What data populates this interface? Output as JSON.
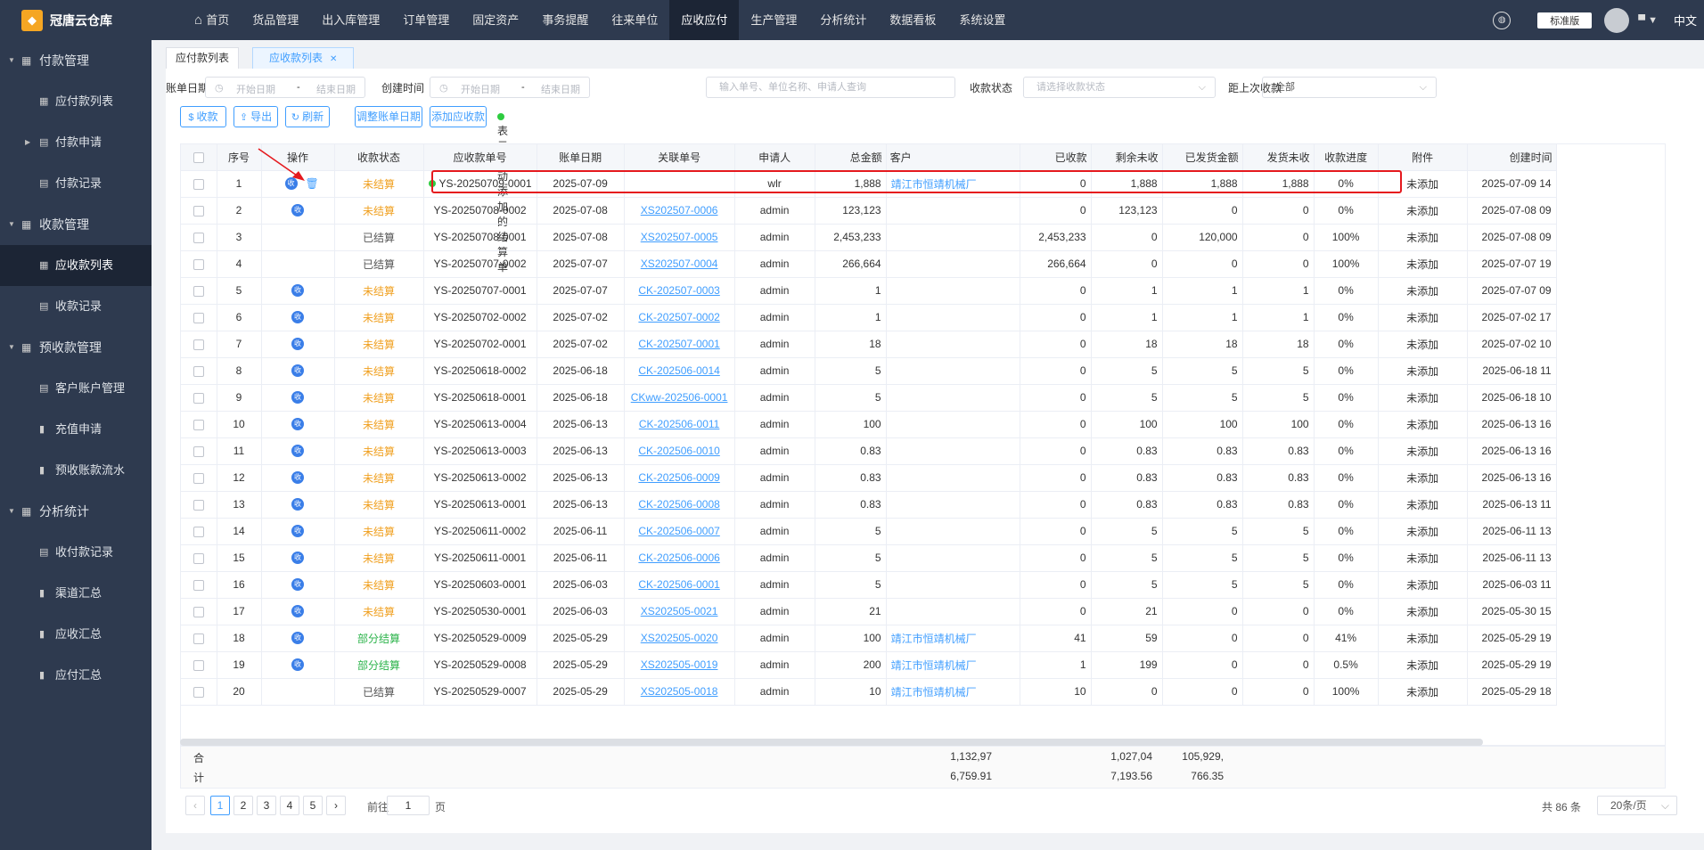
{
  "app": {
    "title": "冠唐云仓库",
    "logo_icon": "logo-icon"
  },
  "topnav": [
    {
      "label": "首页",
      "icon": "home-icon"
    },
    {
      "label": "货品管理"
    },
    {
      "label": "出入库管理"
    },
    {
      "label": "订单管理"
    },
    {
      "label": "固定资产"
    },
    {
      "label": "事务提醒"
    },
    {
      "label": "往来单位"
    },
    {
      "label": "应收应付",
      "active": true
    },
    {
      "label": "生产管理"
    },
    {
      "label": "分析统计"
    },
    {
      "label": "数据看板"
    },
    {
      "label": "系统设置"
    }
  ],
  "topright": {
    "edition": "标准版",
    "lang": "中文"
  },
  "sidebar": [
    {
      "type": "group",
      "label": "付款管理",
      "icon": "grid-icon"
    },
    {
      "type": "item",
      "label": "应付款列表",
      "icon": "table-icon"
    },
    {
      "type": "item",
      "label": "付款申请",
      "icon": "doc-icon",
      "arrow": true
    },
    {
      "type": "item",
      "label": "付款记录",
      "icon": "doc-icon"
    },
    {
      "type": "group",
      "label": "收款管理",
      "icon": "grid-icon"
    },
    {
      "type": "item",
      "label": "应收款列表",
      "icon": "table-icon",
      "active": true
    },
    {
      "type": "item",
      "label": "收款记录",
      "icon": "doc-icon"
    },
    {
      "type": "group",
      "label": "预收款管理",
      "icon": "grid-icon"
    },
    {
      "type": "item",
      "label": "客户账户管理",
      "icon": "doc-icon"
    },
    {
      "type": "item",
      "label": "充值申请",
      "icon": "bar-icon"
    },
    {
      "type": "item",
      "label": "预收账款流水",
      "icon": "bar-icon"
    },
    {
      "type": "group",
      "label": "分析统计",
      "icon": "grid-icon"
    },
    {
      "type": "item",
      "label": "收付款记录",
      "icon": "doc-icon"
    },
    {
      "type": "item",
      "label": "渠道汇总",
      "icon": "bar-icon"
    },
    {
      "type": "item",
      "label": "应收汇总",
      "icon": "bar-icon"
    },
    {
      "type": "item",
      "label": "应付汇总",
      "icon": "bar-icon"
    }
  ],
  "tabs": [
    {
      "label": "应付款列表"
    },
    {
      "label": "应收款列表",
      "active": true
    }
  ],
  "filters": {
    "bill_date_label": "账单日期",
    "start": "开始日期",
    "sep": "-",
    "end": "结束日期",
    "create_time_label": "创建时间",
    "search_placeholder": "输入单号、单位名称、申请人查询",
    "status_label": "收款状态",
    "status_placeholder": "请选择收款状态",
    "last_label": "距上次收款",
    "last_value": "全部"
  },
  "actions": {
    "receive": "收款",
    "export": "导出",
    "refresh": "刷新",
    "adjust": "调整账单日期",
    "add": "添加应收款",
    "hint": "表示手动添加的结算单"
  },
  "columns": [
    "序号",
    "操作",
    "收款状态",
    "应收款单号",
    "账单日期",
    "关联单号",
    "申请人",
    "总金额",
    "客户",
    "已收款",
    "剩余未收",
    "已发货金额",
    "发货未收",
    "收款进度",
    "附件",
    "创建时间"
  ],
  "rows": [
    {
      "no": "1",
      "op": true,
      "del": true,
      "status": "未结算",
      "st": 0,
      "manual": true,
      "code": "YS-20250709-0001",
      "date": "2025-07-09",
      "link": "",
      "linkStyle": "none",
      "applicant": "wlr",
      "total": "1,888",
      "customer": "",
      "received": "0",
      "remain": "1,888",
      "shipped": "1,888",
      "unpaid": "1,888",
      "progress": "0%",
      "attach": "未添加",
      "created": "2025-07-09 14"
    },
    {
      "no": "2",
      "op": true,
      "status": "未结算",
      "st": 0,
      "code": "YS-20250708-0002",
      "date": "2025-07-08",
      "link": "XS202507-0006",
      "linkStyle": "u",
      "applicant": "admin",
      "total": "123,123",
      "customer": "",
      "received": "0",
      "remain": "123,123",
      "shipped": "0",
      "unpaid": "0",
      "progress": "0%",
      "attach": "未添加",
      "created": "2025-07-08 09"
    },
    {
      "no": "3",
      "op": false,
      "status": "已结算",
      "st": 2,
      "code": "YS-20250708-0001",
      "date": "2025-07-08",
      "link": "XS202507-0005",
      "linkStyle": "u",
      "applicant": "admin",
      "total": "2,453,233",
      "customer": "",
      "received": "2,453,233",
      "remain": "0",
      "shipped": "120,000",
      "unpaid": "0",
      "progress": "100%",
      "attach": "未添加",
      "created": "2025-07-08 09"
    },
    {
      "no": "4",
      "op": false,
      "status": "已结算",
      "st": 2,
      "code": "YS-20250707-0002",
      "date": "2025-07-07",
      "link": "XS202507-0004",
      "linkStyle": "u",
      "applicant": "admin",
      "total": "266,664",
      "customer": "",
      "received": "266,664",
      "remain": "0",
      "shipped": "0",
      "unpaid": "0",
      "progress": "100%",
      "attach": "未添加",
      "created": "2025-07-07 19"
    },
    {
      "no": "5",
      "op": true,
      "status": "未结算",
      "st": 0,
      "code": "YS-20250707-0001",
      "date": "2025-07-07",
      "link": "CK-202507-0003",
      "linkStyle": "u",
      "applicant": "admin",
      "total": "1",
      "customer": "",
      "received": "0",
      "remain": "1",
      "shipped": "1",
      "unpaid": "1",
      "progress": "0%",
      "attach": "未添加",
      "created": "2025-07-07 09"
    },
    {
      "no": "6",
      "op": true,
      "status": "未结算",
      "st": 0,
      "code": "YS-20250702-0002",
      "date": "2025-07-02",
      "link": "CK-202507-0002",
      "linkStyle": "u",
      "applicant": "admin",
      "total": "1",
      "customer": "",
      "received": "0",
      "remain": "1",
      "shipped": "1",
      "unpaid": "1",
      "progress": "0%",
      "attach": "未添加",
      "created": "2025-07-02 17"
    },
    {
      "no": "7",
      "op": true,
      "status": "未结算",
      "st": 0,
      "code": "YS-20250702-0001",
      "date": "2025-07-02",
      "link": "CK-202507-0001",
      "linkStyle": "u",
      "applicant": "admin",
      "total": "18",
      "customer": "",
      "received": "0",
      "remain": "18",
      "shipped": "18",
      "unpaid": "18",
      "progress": "0%",
      "attach": "未添加",
      "created": "2025-07-02 10"
    },
    {
      "no": "8",
      "op": true,
      "status": "未结算",
      "st": 0,
      "code": "YS-20250618-0002",
      "date": "2025-06-18",
      "link": "CK-202506-0014",
      "linkStyle": "u",
      "applicant": "admin",
      "total": "5",
      "customer": "",
      "received": "0",
      "remain": "5",
      "shipped": "5",
      "unpaid": "5",
      "progress": "0%",
      "attach": "未添加",
      "created": "2025-06-18 11"
    },
    {
      "no": "9",
      "op": true,
      "status": "未结算",
      "st": 0,
      "code": "YS-20250618-0001",
      "date": "2025-06-18",
      "link": "CKww-202506-0001",
      "linkStyle": "u",
      "applicant": "admin",
      "total": "5",
      "customer": "",
      "received": "0",
      "remain": "5",
      "shipped": "5",
      "unpaid": "5",
      "progress": "0%",
      "attach": "未添加",
      "created": "2025-06-18 10"
    },
    {
      "no": "10",
      "op": true,
      "status": "未结算",
      "st": 0,
      "code": "YS-20250613-0004",
      "date": "2025-06-13",
      "link": "CK-202506-0011",
      "linkStyle": "u",
      "applicant": "admin",
      "total": "100",
      "customer": "",
      "received": "0",
      "remain": "100",
      "shipped": "100",
      "unpaid": "100",
      "progress": "0%",
      "attach": "未添加",
      "created": "2025-06-13 16"
    },
    {
      "no": "11",
      "op": true,
      "status": "未结算",
      "st": 0,
      "code": "YS-20250613-0003",
      "date": "2025-06-13",
      "link": "CK-202506-0010",
      "linkStyle": "u",
      "applicant": "admin",
      "total": "0.83",
      "customer": "",
      "received": "0",
      "remain": "0.83",
      "shipped": "0.83",
      "unpaid": "0.83",
      "progress": "0%",
      "attach": "未添加",
      "created": "2025-06-13 16"
    },
    {
      "no": "12",
      "op": true,
      "status": "未结算",
      "st": 0,
      "code": "YS-20250613-0002",
      "date": "2025-06-13",
      "link": "CK-202506-0009",
      "linkStyle": "u",
      "applicant": "admin",
      "total": "0.83",
      "customer": "",
      "received": "0",
      "remain": "0.83",
      "shipped": "0.83",
      "unpaid": "0.83",
      "progress": "0%",
      "attach": "未添加",
      "created": "2025-06-13 16"
    },
    {
      "no": "13",
      "op": true,
      "status": "未结算",
      "st": 0,
      "code": "YS-20250613-0001",
      "date": "2025-06-13",
      "link": "CK-202506-0008",
      "linkStyle": "u",
      "applicant": "admin",
      "total": "0.83",
      "customer": "",
      "received": "0",
      "remain": "0.83",
      "shipped": "0.83",
      "unpaid": "0.83",
      "progress": "0%",
      "attach": "未添加",
      "created": "2025-06-13 11"
    },
    {
      "no": "14",
      "op": true,
      "status": "未结算",
      "st": 0,
      "code": "YS-20250611-0002",
      "date": "2025-06-11",
      "link": "CK-202506-0007",
      "linkStyle": "u",
      "applicant": "admin",
      "total": "5",
      "customer": "",
      "received": "0",
      "remain": "5",
      "shipped": "5",
      "unpaid": "5",
      "progress": "0%",
      "attach": "未添加",
      "created": "2025-06-11 13"
    },
    {
      "no": "15",
      "op": true,
      "status": "未结算",
      "st": 0,
      "code": "YS-20250611-0001",
      "date": "2025-06-11",
      "link": "CK-202506-0006",
      "linkStyle": "u",
      "applicant": "admin",
      "total": "5",
      "customer": "",
      "received": "0",
      "remain": "5",
      "shipped": "5",
      "unpaid": "5",
      "progress": "0%",
      "attach": "未添加",
      "created": "2025-06-11 13"
    },
    {
      "no": "16",
      "op": true,
      "status": "未结算",
      "st": 0,
      "code": "YS-20250603-0001",
      "date": "2025-06-03",
      "link": "CK-202506-0001",
      "linkStyle": "u",
      "applicant": "admin",
      "total": "5",
      "customer": "",
      "received": "0",
      "remain": "5",
      "shipped": "5",
      "unpaid": "5",
      "progress": "0%",
      "attach": "未添加",
      "created": "2025-06-03 11"
    },
    {
      "no": "17",
      "op": true,
      "status": "未结算",
      "st": 0,
      "code": "YS-20250530-0001",
      "date": "2025-06-03",
      "link": "XS202505-0021",
      "linkStyle": "u",
      "applicant": "admin",
      "total": "21",
      "customer": "",
      "received": "0",
      "remain": "21",
      "shipped": "0",
      "unpaid": "0",
      "progress": "0%",
      "attach": "未添加",
      "created": "2025-05-30 15"
    },
    {
      "no": "18",
      "op": true,
      "status": "部分结算",
      "st": 1,
      "code": "YS-20250529-0009",
      "date": "2025-05-29",
      "link": "XS202505-0020",
      "linkStyle": "u",
      "applicant": "admin",
      "total": "100",
      "customer": "靖江市恒靖机械厂",
      "received": "41",
      "remain": "59",
      "shipped": "0",
      "unpaid": "0",
      "progress": "41%",
      "attach": "未添加",
      "created": "2025-05-29 19"
    },
    {
      "no": "19",
      "op": true,
      "status": "部分结算",
      "st": 1,
      "code": "YS-20250529-0008",
      "date": "2025-05-29",
      "link": "XS202505-0019",
      "linkStyle": "u",
      "applicant": "admin",
      "total": "200",
      "customer": "靖江市恒靖机械厂",
      "received": "1",
      "remain": "199",
      "shipped": "0",
      "unpaid": "0",
      "progress": "0.5%",
      "attach": "未添加",
      "created": "2025-05-29 19"
    },
    {
      "no": "20",
      "op": false,
      "status": "已结算",
      "st": 2,
      "code": "YS-20250529-0007",
      "date": "2025-05-29",
      "link": "XS202505-0018",
      "linkStyle": "u",
      "applicant": "admin",
      "total": "10",
      "customer": "靖江市恒靖机械厂",
      "received": "10",
      "remain": "0",
      "shipped": "0",
      "unpaid": "0",
      "progress": "100%",
      "attach": "未添加",
      "created": "2025-05-29 18"
    }
  ],
  "row1_customer": "靖江市恒靖机械厂",
  "summary": {
    "label1": "合",
    "label2": "计",
    "total1": "1,132,97",
    "total2": "6,759.91",
    "received1": "1,027,04",
    "received2": "7,193.56",
    "remain1": "105,929,",
    "remain2": "766.35"
  },
  "pager": {
    "pages": [
      "1",
      "2",
      "3",
      "4",
      "5"
    ],
    "prev": "‹",
    "next": "›",
    "goto_label": "前往",
    "goto_value": "1",
    "page_unit": "页",
    "total": "共 86 条",
    "size": "20条/页"
  },
  "colors": {
    "sidebar": "#2e3a4f",
    "active": "#1c2535",
    "accent": "#409eff",
    "highlight": "#e5191e"
  }
}
